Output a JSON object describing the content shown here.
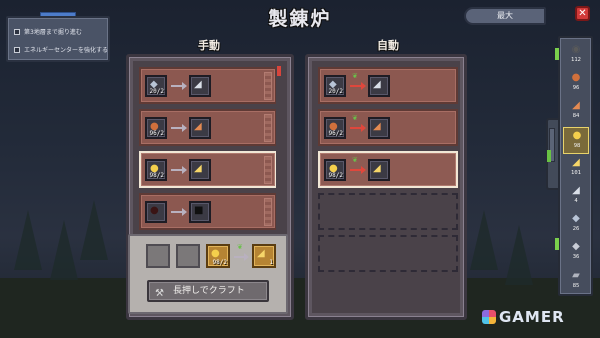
{
  "title": "製錬炉",
  "options": [
    {
      "label": "第3地層まで掘り進む",
      "checked": false
    },
    {
      "label": "エネルギーセンターを強化する",
      "checked": false
    }
  ],
  "max_label": "最大",
  "close_glyph": "✕",
  "manual": {
    "label": "手動",
    "recipes": [
      {
        "input_icon": "iron-ore-icon",
        "input_glyph": "◆",
        "input_qty": "20/2",
        "output_icon": "iron-bar-icon",
        "output_glyph": "◢",
        "input_color": "#b8c4d6",
        "output_color": "#d9dfe8",
        "selected": false
      },
      {
        "input_icon": "copper-ore-icon",
        "input_glyph": "●",
        "input_qty": "96/2",
        "output_icon": "copper-bar-icon",
        "output_glyph": "◢",
        "input_color": "#d0703c",
        "output_color": "#e48a52",
        "selected": false
      },
      {
        "input_icon": "gold-ore-icon",
        "input_glyph": "●",
        "input_qty": "98/2",
        "output_icon": "gold-bar-icon",
        "output_glyph": "◢",
        "input_color": "#f4cf4c",
        "output_color": "#f6d669",
        "selected": true
      },
      {
        "input_icon": "unknown-ore-icon",
        "input_glyph": "●",
        "input_qty": "",
        "output_icon": "unknown-bar-icon",
        "output_glyph": "■",
        "input_color": "#3a1414",
        "output_color": "#101010",
        "selected": false
      }
    ],
    "craft": {
      "ingredient_qty": "98/2",
      "result_qty": "1",
      "button_label": "長押しでクラフト"
    }
  },
  "auto": {
    "label": "自動",
    "recipes": [
      {
        "input_icon": "iron-ore-icon",
        "input_glyph": "◆",
        "input_qty": "20/2",
        "output_icon": "iron-bar-icon",
        "output_glyph": "◢",
        "input_color": "#b8c4d6",
        "output_color": "#d9dfe8",
        "selected": false
      },
      {
        "input_icon": "copper-ore-icon",
        "input_glyph": "●",
        "input_qty": "96/2",
        "output_icon": "copper-bar-icon",
        "output_glyph": "◢",
        "input_color": "#d0703c",
        "output_color": "#e48a52",
        "selected": false
      },
      {
        "input_icon": "gold-ore-icon",
        "input_glyph": "●",
        "input_qty": "98/2",
        "output_icon": "gold-bar-icon",
        "output_glyph": "◢",
        "input_color": "#f4cf4c",
        "output_color": "#f6d669",
        "selected": true
      }
    ],
    "empty_slots": 2
  },
  "inventory": [
    {
      "icon": "coal-icon",
      "glyph": "◉",
      "color": "#5a5a5a",
      "count": "112",
      "selected": false
    },
    {
      "icon": "copper-ore-icon",
      "glyph": "●",
      "color": "#d0703c",
      "count": "96",
      "selected": false
    },
    {
      "icon": "copper-bar-icon",
      "glyph": "◢",
      "color": "#e48a52",
      "count": "84",
      "selected": false
    },
    {
      "icon": "gold-ore-icon",
      "glyph": "●",
      "color": "#f4cf4c",
      "count": "98",
      "selected": true
    },
    {
      "icon": "gold-bar-icon",
      "glyph": "◢",
      "color": "#f6d669",
      "count": "101",
      "selected": false
    },
    {
      "icon": "iron-bar-icon",
      "glyph": "◢",
      "color": "#d9dfe8",
      "count": "4",
      "selected": false
    },
    {
      "icon": "iron-ore-icon",
      "glyph": "◆",
      "color": "#b8c4d6",
      "count": "26",
      "selected": false
    },
    {
      "icon": "silver-ore-icon",
      "glyph": "◆",
      "color": "#c8ccd6",
      "count": "36",
      "selected": false
    },
    {
      "icon": "stone-icon",
      "glyph": "▰",
      "color": "#b0b4be",
      "count": "85",
      "selected": false
    }
  ],
  "watermark": "GAMER"
}
